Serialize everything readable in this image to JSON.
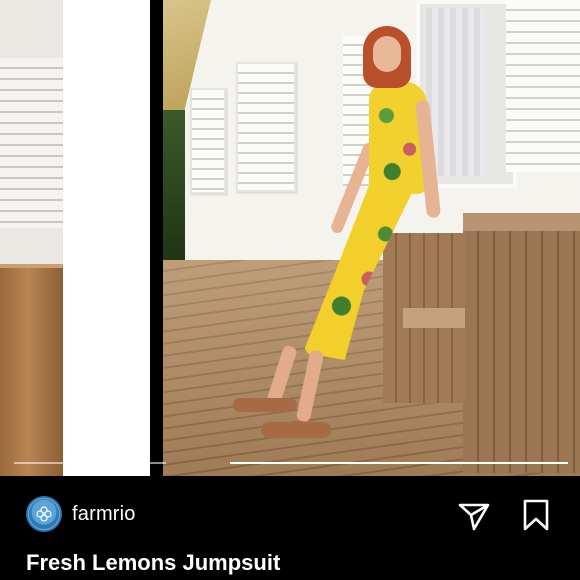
{
  "post": {
    "username": "farmrio",
    "avatar_icon": "flower-logo-icon",
    "caption": "Fresh Lemons Jumpsuit"
  },
  "actions": {
    "share_icon": "send-icon",
    "save_icon": "bookmark-icon"
  },
  "colors": {
    "background": "#000000",
    "text": "#ffffff",
    "avatar": "#2b78b8"
  }
}
